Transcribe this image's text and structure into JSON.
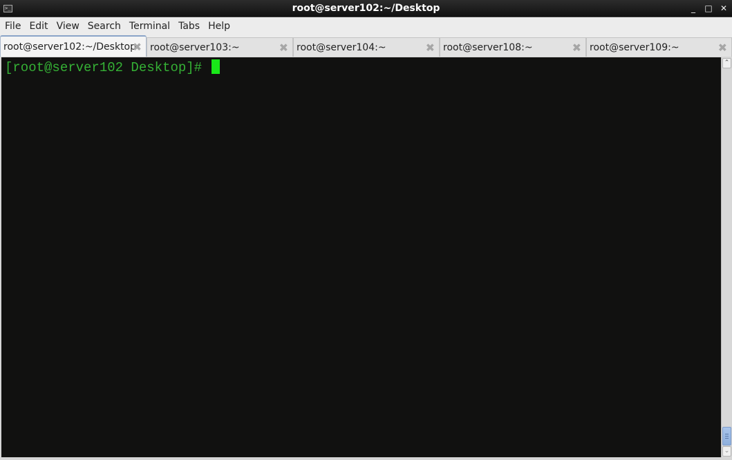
{
  "window": {
    "title": "root@server102:~/Desktop",
    "app_icon": "terminal-icon",
    "controls": {
      "minimize": "_",
      "maximize": "□",
      "close": "✕"
    }
  },
  "menubar": {
    "items": [
      "File",
      "Edit",
      "View",
      "Search",
      "Terminal",
      "Tabs",
      "Help"
    ]
  },
  "tabs": [
    {
      "label": "root@server102:~/Desktop",
      "active": true,
      "close": "✖"
    },
    {
      "label": "root@server103:~",
      "active": false,
      "close": "✖"
    },
    {
      "label": "root@server104:~",
      "active": false,
      "close": "✖"
    },
    {
      "label": "root@server108:~",
      "active": false,
      "close": "✖"
    },
    {
      "label": "root@server109:~",
      "active": false,
      "close": "✖"
    }
  ],
  "terminal": {
    "prompt": "[root@server102 Desktop]# ",
    "colors": {
      "background": "#111110",
      "text": "#35b135",
      "cursor": "#19e819"
    }
  },
  "scrollbar": {
    "up": "⌃",
    "down": "⌄",
    "position": "bottom"
  }
}
